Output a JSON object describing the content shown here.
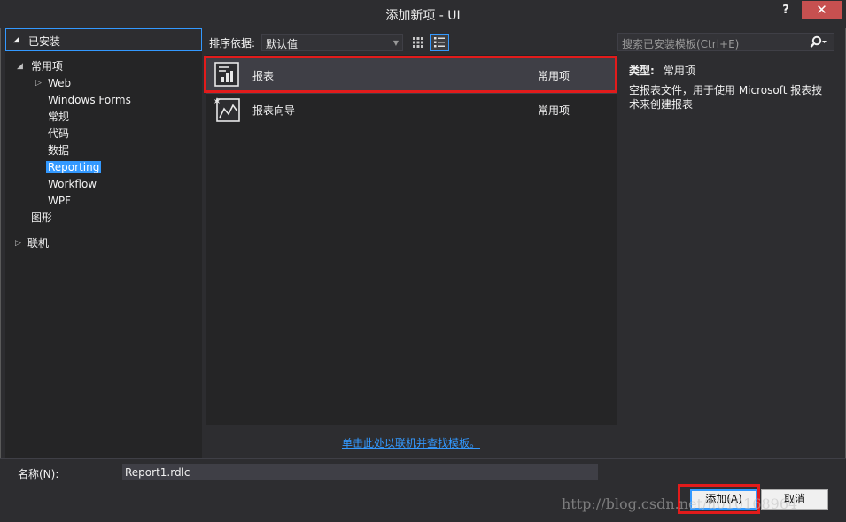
{
  "window": {
    "title": "添加新项 - UI",
    "help": "?",
    "close": "✕"
  },
  "tree": {
    "header": "已安装",
    "nodes": [
      {
        "label": "常用项",
        "twisty": "◢"
      },
      {
        "label": "Web",
        "twisty": "▷"
      },
      {
        "label": "Windows Forms"
      },
      {
        "label": "常规"
      },
      {
        "label": "代码"
      },
      {
        "label": "数据"
      },
      {
        "label": "Reporting",
        "selected": true
      },
      {
        "label": "Workflow"
      },
      {
        "label": "WPF"
      },
      {
        "label": "图形"
      },
      {
        "label": "联机",
        "twisty": "▷"
      }
    ]
  },
  "toolbar": {
    "sort_label": "排序依据:",
    "sort_value": "默认值"
  },
  "search": {
    "placeholder": "搜索已安装模板(Ctrl+E)"
  },
  "templates": [
    {
      "name": "报表",
      "category": "常用项",
      "icon": "report-icon",
      "selected": true
    },
    {
      "name": "报表向导",
      "category": "常用项",
      "icon": "report-wizard-icon"
    }
  ],
  "details": {
    "type_label": "类型:",
    "type_value": "常用项",
    "description": "空报表文件，用于使用 Microsoft 报表技术来创建报表"
  },
  "online_link": "单击此处以联机并查找模板。",
  "bottom": {
    "name_label": "名称(N):",
    "name_value": "Report1.rdlc",
    "add_label": "添加(A)",
    "cancel_label": "取消"
  },
  "watermark": "http://blog.csdn.net/u010168964",
  "colors": {
    "accent": "#3399ff",
    "highlight_box": "#e21b1b",
    "background": "#2d2d30"
  }
}
